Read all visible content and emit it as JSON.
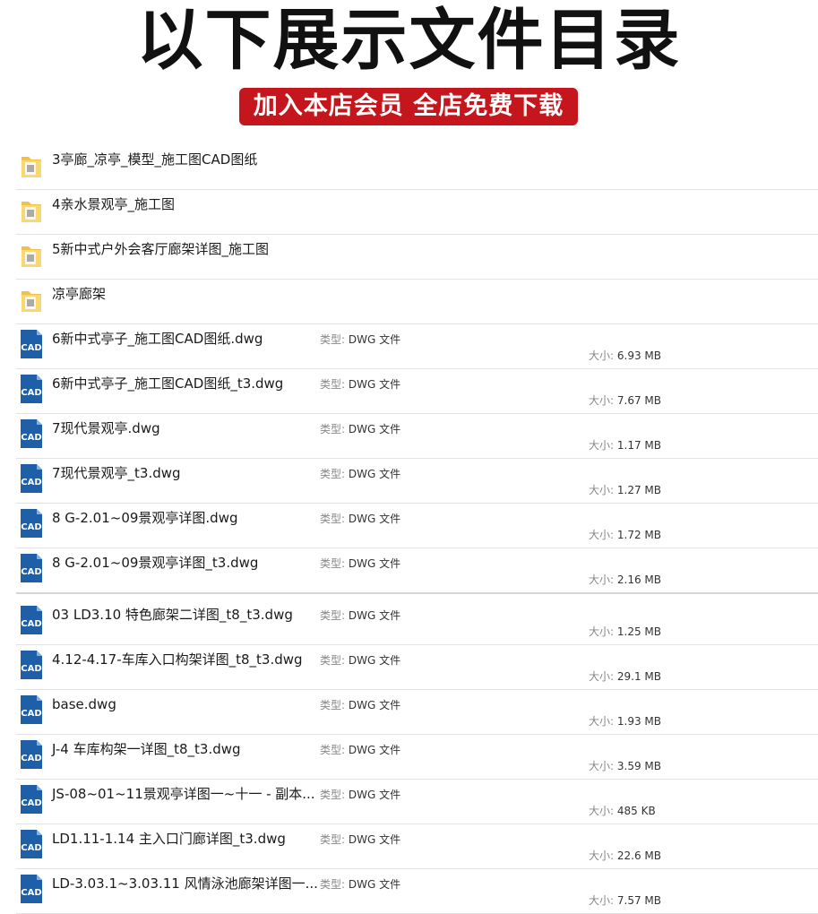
{
  "header": {
    "title": "以下展示文件目录",
    "banner": "加入本店会员 全店免费下载"
  },
  "labels": {
    "type_prefix": "类型:",
    "size_prefix": "大小:"
  },
  "folders": [
    {
      "name": "3亭廊_凉亭_模型_施工图CAD图纸",
      "icon": "folder-icon"
    },
    {
      "name": "4亲水景观亭_施工图",
      "icon": "folder-icon"
    },
    {
      "name": "5新中式户外会客厅廊架详图_施工图",
      "icon": "folder-icon"
    },
    {
      "name": "凉亭廊架",
      "icon": "folder-icon"
    }
  ],
  "files": [
    {
      "name": "6新中式亭子_施工图CAD图纸.dwg",
      "type": "DWG 文件",
      "size": "6.93 MB",
      "icon": "cad-file-icon"
    },
    {
      "name": "6新中式亭子_施工图CAD图纸_t3.dwg",
      "type": "DWG 文件",
      "size": "7.67 MB",
      "icon": "cad-file-icon"
    },
    {
      "name": "7现代景观亭.dwg",
      "type": "DWG 文件",
      "size": "1.17 MB",
      "icon": "cad-file-icon"
    },
    {
      "name": "7现代景观亭_t3.dwg",
      "type": "DWG 文件",
      "size": "1.27 MB",
      "icon": "cad-file-icon"
    },
    {
      "name": "8 G-2.01~09景观亭详图.dwg",
      "type": "DWG 文件",
      "size": "1.72 MB",
      "icon": "cad-file-icon"
    },
    {
      "name": "8 G-2.01~09景观亭详图_t3.dwg",
      "type": "DWG 文件",
      "size": "2.16 MB",
      "icon": "cad-file-icon"
    },
    {
      "name": "03 LD3.10 特色廊架二详图_t8_t3.dwg",
      "type": "DWG 文件",
      "size": "1.25 MB",
      "icon": "cad-file-icon"
    },
    {
      "name": "4.12-4.17-车库入口构架详图_t8_t3.dwg",
      "type": "DWG 文件",
      "size": "29.1 MB",
      "icon": "cad-file-icon"
    },
    {
      "name": "base.dwg",
      "type": "DWG 文件",
      "size": "1.93 MB",
      "icon": "cad-file-icon"
    },
    {
      "name": "J-4 车库构架一详图_t8_t3.dwg",
      "type": "DWG 文件",
      "size": "3.59 MB",
      "icon": "cad-file-icon"
    },
    {
      "name": "JS-08~01~11景观亭详图一~十一 - 副本...",
      "type": "DWG 文件",
      "size": "485 KB",
      "icon": "cad-file-icon"
    },
    {
      "name": "LD1.11-1.14 主入口门廊详图_t3.dwg",
      "type": "DWG 文件",
      "size": "22.6 MB",
      "icon": "cad-file-icon"
    },
    {
      "name": "LD-3.03.1~3.03.11 风情泳池廊架详图一...",
      "type": "DWG 文件",
      "size": "7.57 MB",
      "icon": "cad-file-icon"
    }
  ]
}
